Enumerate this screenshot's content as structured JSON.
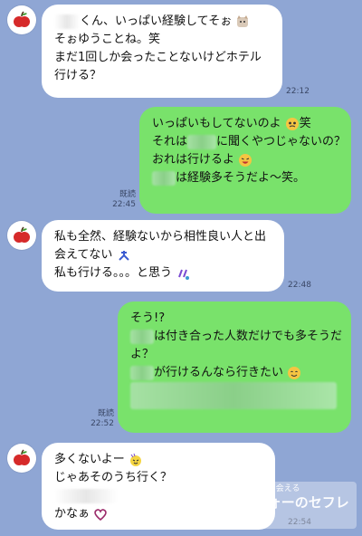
{
  "messages": [
    {
      "side": "left",
      "lines": [
        "くん、いっぱい経験してそぉ",
        "そぉゆうことね。笑",
        "",
        "まだ1回しか会ったことないけどホテル",
        "行ける？"
      ],
      "time": "22:12"
    },
    {
      "side": "right",
      "lines": [
        "いっぱいもしてないのよ",
        "それは",
        "おれは行けるよ",
        "",
        "は経験多そうだよ〜笑。"
      ],
      "line_extras": [
        "笑",
        "に聞くやつじゃないの？"
      ],
      "read": "既読",
      "time": "22:45"
    },
    {
      "side": "left",
      "lines": [
        "私も全然、経験ないから相性良い人と出",
        "会えてない",
        "私も行ける。。。と思う"
      ],
      "time": "22:48"
    },
    {
      "side": "right",
      "lines": [
        "そう!?",
        "は付き合った人数だけでも多そうだ",
        "よ？",
        "",
        "が行けるんなら行きたい"
      ],
      "read": "既読",
      "time": "22:52"
    },
    {
      "side": "left",
      "lines": [
        "多くないよー",
        "じゃあそのうち行く？",
        "",
        "かなぁ"
      ],
      "time": "22:54"
    }
  ],
  "watermark": {
    "line1": "既婚者でも出会える",
    "line2": "アラフォーのセフレ学"
  },
  "colors": {
    "background": "#8fa6d4",
    "left_bubble": "#ffffff",
    "right_bubble": "#79e26b"
  }
}
